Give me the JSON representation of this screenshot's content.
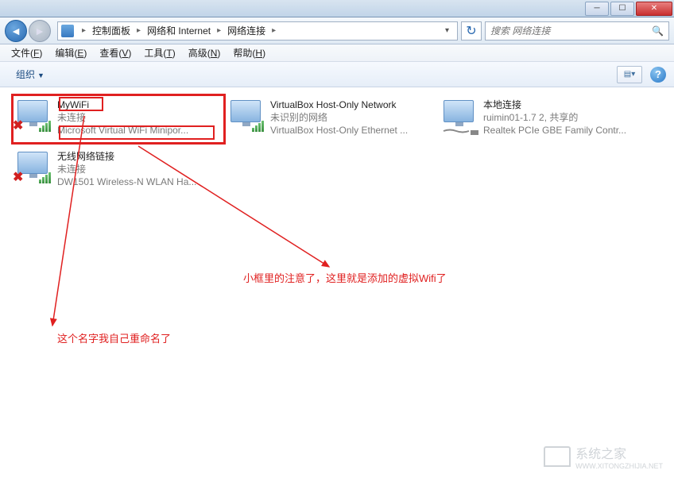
{
  "window": {
    "min": "─",
    "max": "☐",
    "close": "✕"
  },
  "breadcrumbs": [
    "控制面板",
    "网络和 Internet",
    "网络连接"
  ],
  "search": {
    "placeholder": "搜索 网络连接"
  },
  "menu": [
    {
      "pre": "文件(",
      "u": "F",
      "post": ")"
    },
    {
      "pre": "编辑(",
      "u": "E",
      "post": ")"
    },
    {
      "pre": "查看(",
      "u": "V",
      "post": ")"
    },
    {
      "pre": "工具(",
      "u": "T",
      "post": ")"
    },
    {
      "pre": "高级(",
      "u": "N",
      "post": ")"
    },
    {
      "pre": "帮助(",
      "u": "H",
      "post": ")"
    }
  ],
  "toolbar": {
    "organize": "组织"
  },
  "connections": [
    {
      "name": "MyWiFi",
      "status": "未连接",
      "device": "Microsoft Virtual WiFi Minipor...",
      "type": "wifi",
      "error": true
    },
    {
      "name": "VirtualBox Host-Only Network",
      "status": "未识别的网络",
      "device": "VirtualBox Host-Only Ethernet ...",
      "type": "wifi",
      "error": false
    },
    {
      "name": "本地连接",
      "status": "ruimin01-1.7  2, 共享的",
      "device": "Realtek PCIe GBE Family Contr...",
      "type": "wired",
      "error": false
    },
    {
      "name": "无线网络链接",
      "status": "未连接",
      "device": "DW1501 Wireless-N WLAN Ha...",
      "type": "wifi",
      "error": true
    }
  ],
  "annotations": {
    "a1": "小框里的注意了，这里就是添加的虚拟Wifi了",
    "a2": "这个名字我自己重命名了"
  },
  "watermark": {
    "text": "系统之家",
    "sub": "WWW.XITONGZHIJIA.NET"
  }
}
